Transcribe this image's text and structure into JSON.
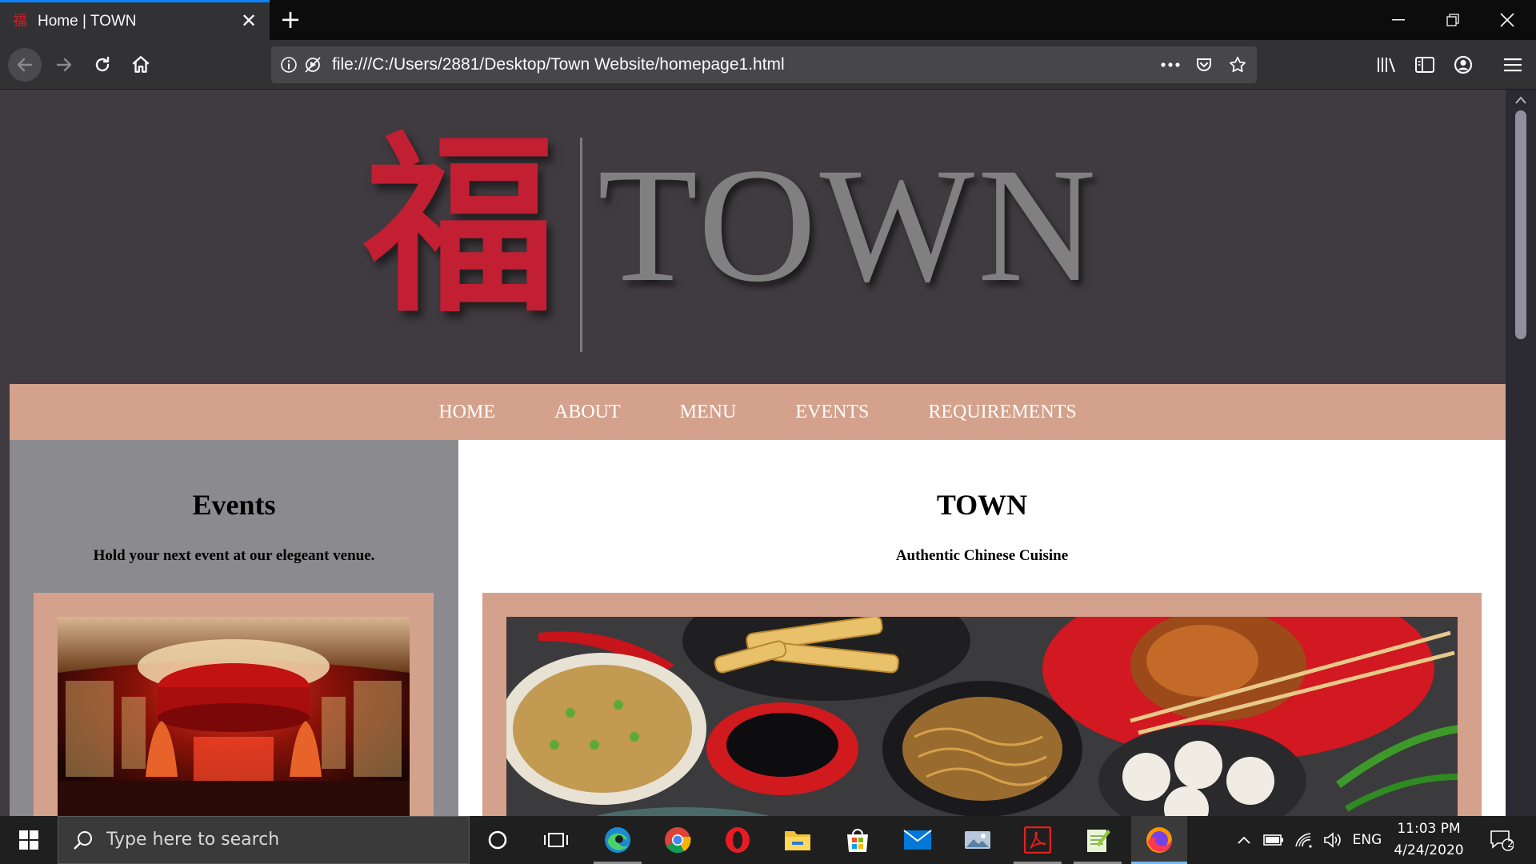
{
  "browser": {
    "tab_title": "Home | TOWN",
    "tab_favicon_glyph": "福",
    "url": "file:///C:/Users/2881/Desktop/Town Website/homepage1.html",
    "accent_color": "#0a84ff"
  },
  "page": {
    "logo": {
      "glyph": "福",
      "wordmark": "TOWN",
      "glyph_color": "#c21f32",
      "wordmark_color": "#808080"
    },
    "nav": {
      "items": [
        {
          "label": "HOME"
        },
        {
          "label": "ABOUT"
        },
        {
          "label": "MENU"
        },
        {
          "label": "EVENTS"
        },
        {
          "label": "REQUIREMENTS"
        }
      ],
      "background": "#d4a18c"
    },
    "sidebar": {
      "title": "Events",
      "subtitle": "Hold your next event at our elegeant venue."
    },
    "main": {
      "title": "TOWN",
      "subtitle": "Authentic Chinese Cuisine"
    }
  },
  "taskbar": {
    "search_placeholder": "Type here to search",
    "language": "ENG",
    "time": "11:03 PM",
    "date": "4/24/2020",
    "notification_count": "2"
  }
}
